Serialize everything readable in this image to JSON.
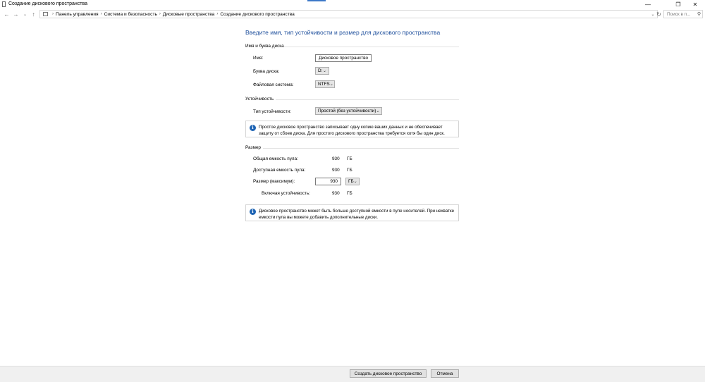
{
  "window": {
    "title": "Создание дискового пространства",
    "minimize_glyph": "—",
    "maximize_glyph": "❐",
    "close_glyph": "✕"
  },
  "nav": {
    "back_glyph": "←",
    "forward_glyph": "→",
    "recent_glyph": "⌄",
    "up_glyph": "↑",
    "breadcrumbs": [
      "Панель управления",
      "Система и безопасность",
      "Дисковые пространства",
      "Создание дискового пространства"
    ],
    "separator": "›",
    "dropdown_glyph": "⌄",
    "refresh_glyph": "↻",
    "search_placeholder": "Поиск в п...",
    "search_glyph": "⚲"
  },
  "main": {
    "heading": "Введите имя, тип устойчивости и размер для дискового пространства",
    "name_section": {
      "title": "Имя и буква диска",
      "name_label": "Имя:",
      "name_value": "Дисковое пространство",
      "letter_label": "Буква диска:",
      "letter_value": "D:",
      "fs_label": "Файловая система:",
      "fs_value": "NTFS"
    },
    "resiliency_section": {
      "title": "Устойчивость",
      "type_label": "Тип устойчивости:",
      "type_value": "Простой (без устойчивости)",
      "info": "Простое дисковое пространство записывает одну копию ваших данных и не обеспечивает защиту от сбоев диска. Для простого дискового пространства требуется хотя бы один диск."
    },
    "size_section": {
      "title": "Размер",
      "total_label": "Общая емкость пула:",
      "total_value": "930",
      "total_unit": "ГБ",
      "available_label": "Доступная емкость пула:",
      "available_value": "930",
      "available_unit": "ГБ",
      "size_label": "Размер (максимум):",
      "size_value": "930",
      "size_unit": "ГБ",
      "incl_label": "Включая устойчивость:",
      "incl_value": "930",
      "incl_unit": "ГБ",
      "info": "Дисковое пространство может быть больше доступной емкости в пуле носителей. При нехватке емкости пула вы можете добавить дополнительные диски."
    },
    "info_glyph": "i",
    "caret_glyph": "⌄"
  },
  "footer": {
    "create_label": "Создать дисковое пространство",
    "cancel_label": "Отмена"
  }
}
